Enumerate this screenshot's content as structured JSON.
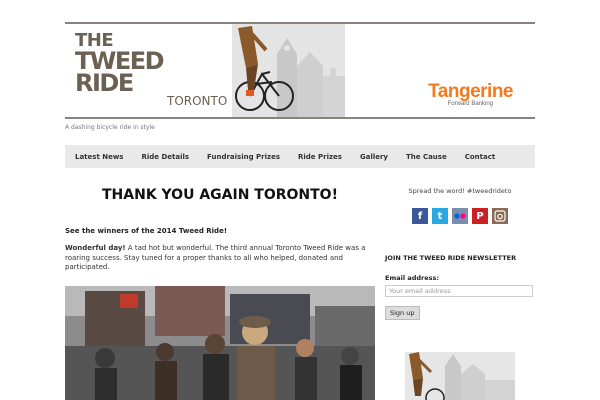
{
  "header": {
    "logo_the": "THE",
    "logo_main": "TWEED RIDE",
    "logo_city": "TORONTO",
    "sponsor_name": "Tangerine",
    "sponsor_tagline": "Forward Banking",
    "tagline": "A dashing bicycle ride in style"
  },
  "nav": {
    "items": [
      "Latest News",
      "Ride Details",
      "Fundraising Prizes",
      "Ride Prizes",
      "Gallery",
      "The Cause",
      "Contact"
    ]
  },
  "main": {
    "headline": "THANK YOU AGAIN TORONTO!",
    "winners_link": "See the winners of the 2014 Tweed Ride!",
    "para_bold": "Wonderful day!",
    "para_text": " A tad hot but wonderful. The third annual Toronto Tweed Ride was a roaring success. Stay tuned for a proper thanks to all who helped, donated and participated."
  },
  "sidebar": {
    "spread": "Spread the word! #tweedrideto",
    "social_icons": [
      "facebook-icon",
      "twitter-icon",
      "flickr-icon",
      "pinterest-icon",
      "instagram-icon"
    ],
    "newsletter_title": "JOIN THE TWEED RIDE NEWSLETTER",
    "email_label": "Email address:",
    "email_placeholder": "Your email address",
    "signup_label": "Sign up"
  },
  "colors": {
    "brand_brown": "#6b6052",
    "sponsor_orange": "#f47a20",
    "nav_bg": "#e9e9e9"
  }
}
